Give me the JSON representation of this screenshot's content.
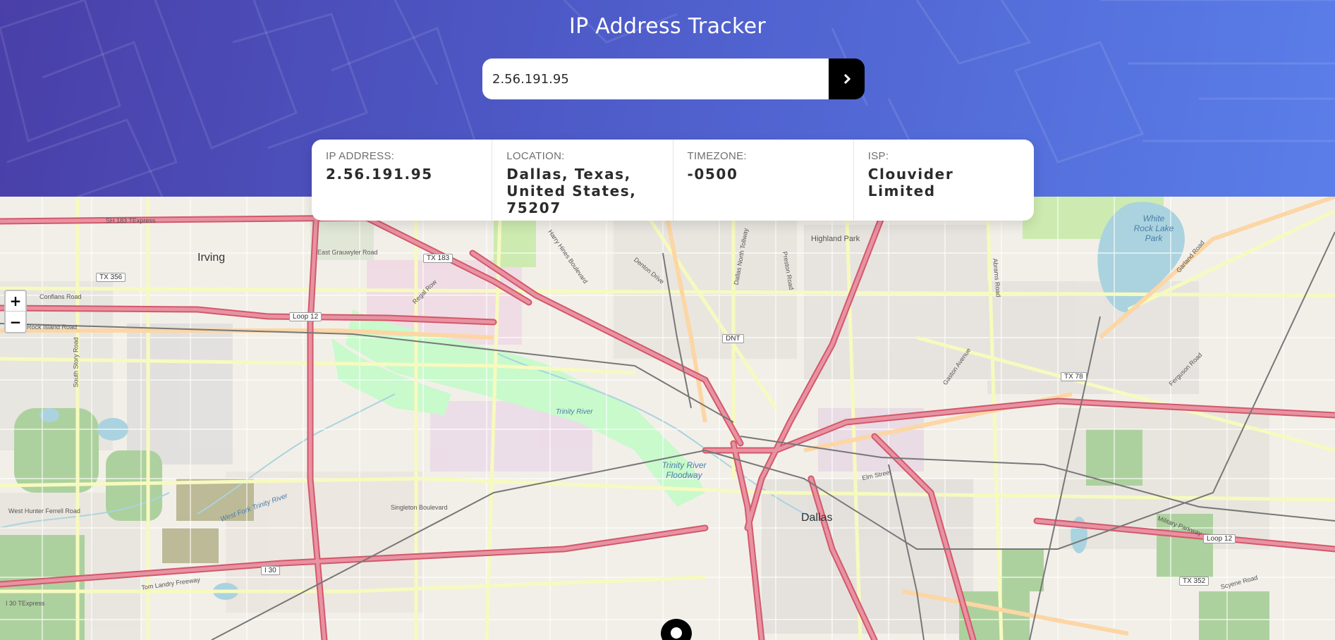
{
  "header": {
    "title": "IP Address Tracker",
    "search_value": "2.56.191.95",
    "submit_icon": "chevron-right-icon"
  },
  "info": {
    "ip_label": "IP ADDRESS:",
    "ip_value": "2.56.191.95",
    "location_label": "LOCATION:",
    "location_value_line1": "Dallas, Texas,",
    "location_value_line2": "United States,",
    "location_value_line3": "75207",
    "timezone_label": "TIMEZONE:",
    "timezone_value": "-0500",
    "isp_label": "ISP:",
    "isp_value": "Clouvider Limited"
  },
  "map": {
    "zoom_in": "+",
    "zoom_out": "−",
    "marker_icon": "location-pin-icon",
    "labels": {
      "dallas": "Dallas",
      "irving": "Irving",
      "highland_park": "Highland Park",
      "white_rock": "White Rock Lake Park",
      "trinity_floodway": "Trinity River Floodway",
      "trinity_river": "Trinity River",
      "west_fork": "West Fork Trinity River",
      "sh183": "SH 183 TExpress",
      "loop12": "Loop 12",
      "tx183": "TX 183",
      "tx356": "TX 356",
      "tx78": "TX 78",
      "tx352": "TX 352",
      "i30": "I 30",
      "dnt": "DNT",
      "tom_landry": "Tom Landry Freeway",
      "singleton": "Singleton Boulevard",
      "elm_street": "Elm Street",
      "conflans": "Conflans Road",
      "rock_island": "Rock Island Road",
      "east_grauwyler": "East Grauwyler Road",
      "military_parkway": "Military Parkway",
      "west_hunter": "West Hunter Ferrell Road",
      "i30_texpress": "I 30 TExpress",
      "south_story": "South Story Road",
      "regal_row": "Regal Row",
      "harry_hines": "Harry Hines Boulevard",
      "denton_drive": "Denton Drive",
      "dallas_tollway": "Dallas North Tollway",
      "preston_road": "Preston Road",
      "abrams_road": "Abrams Road",
      "garland_road": "Garland Road",
      "ferguson_road": "Ferguson Road",
      "gaston_avenue": "Gaston Avenue",
      "scyene_road": "Scyene Road"
    }
  },
  "colors": {
    "header_start": "#4a3fa8",
    "header_end": "#5a7ee9",
    "button": "#000000",
    "freeway": "#e892a2",
    "primary_road": "#fcd6a4",
    "secondary_road": "#f7fabf",
    "water": "#aad3df",
    "park": "#c8facc"
  }
}
